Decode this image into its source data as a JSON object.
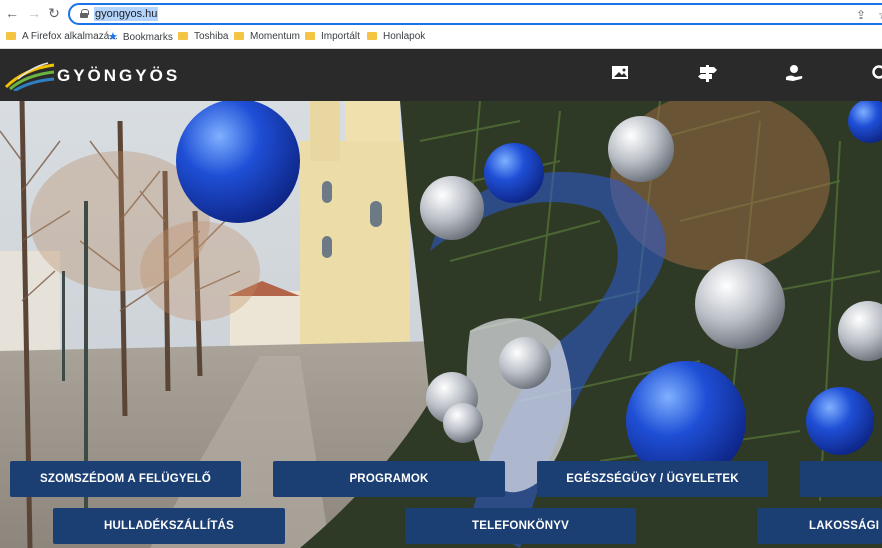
{
  "browser": {
    "url": "gyongyos.hu",
    "bookmarks": [
      {
        "label": "A Firefox alkalmazá...",
        "type": "folder"
      },
      {
        "label": "Bookmarks",
        "type": "star"
      },
      {
        "label": "Toshiba",
        "type": "folder"
      },
      {
        "label": "Momentum",
        "type": "folder"
      },
      {
        "label": "Importált",
        "type": "folder"
      },
      {
        "label": "Honlapok",
        "type": "folder"
      }
    ]
  },
  "site": {
    "logo_text": "GYÖNGYÖS",
    "header_icons": [
      "gallery-icon",
      "signpost-icon",
      "user-hand-icon",
      "search-icon"
    ]
  },
  "quick_links": {
    "row1": [
      "SZOMSZÉDOM A FELÜGYELŐ",
      "PROGRAMOK",
      "EGÉSZSÉGÜGY / ÜGYELETEK",
      ""
    ],
    "row2": [
      "HULLADÉKSZÁLLÍTÁS",
      "TELEFONKÖNYV",
      "LAKOSSÁGI BI"
    ]
  },
  "colors": {
    "header_bg": "#2a2a2a",
    "button_bg": "#1c3f73",
    "accent_blue": "#1a73e8"
  }
}
